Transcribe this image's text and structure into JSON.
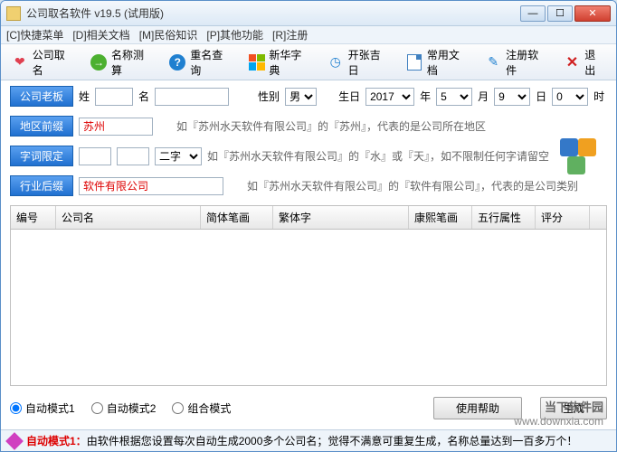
{
  "window": {
    "title": "公司取名软件 v19.5 (试用版)"
  },
  "menu": {
    "m1": "[C]快捷菜单",
    "m2": "[D]相关文档",
    "m3": "[M]民俗知识",
    "m4": "[P]其他功能",
    "m5": "[R]注册"
  },
  "toolbar": {
    "t1": "公司取名",
    "t2": "名称测算",
    "t3": "重名查询",
    "t4": "新华字典",
    "t5": "开张吉日",
    "t6": "常用文档",
    "t7": "注册软件",
    "t8": "退出"
  },
  "form": {
    "boss_btn": "公司老板",
    "surname_lbl": "姓",
    "surname_val": "",
    "given_lbl": "名",
    "given_val": "",
    "gender_lbl": "性别",
    "gender_val": "男",
    "birth_lbl": "生日",
    "year_val": "2017",
    "year_sfx": "年",
    "month_val": "5",
    "month_sfx": "月",
    "day_val": "9",
    "day_sfx": "日",
    "hour_val": "0",
    "hour_sfx": "时",
    "region_btn": "地区前缀",
    "region_val": "苏州",
    "region_hint": "如『苏州水天软件有限公司』的『苏州』，代表的是公司所在地区",
    "limit_btn": "字词限定",
    "limit_val1": "",
    "limit_val2": "",
    "limit_sel": "二字",
    "limit_hint": "如『苏州水天软件有限公司』的『水』或『天』，如不限制任何字请留空",
    "suffix_btn": "行业后缀",
    "suffix_val": "软件有限公司",
    "suffix_hint": "如『苏州水天软件有限公司』的『软件有限公司』，代表的是公司类别"
  },
  "table": {
    "h0": "编号",
    "h1": "公司名",
    "h2": "简体笔画",
    "h3": "繁体字",
    "h4": "康熙笔画",
    "h5": "五行属性",
    "h6": "评分"
  },
  "modes": {
    "m1": "自动模式1",
    "m2": "自动模式2",
    "m3": "组合模式"
  },
  "buttons": {
    "help": "使用帮助",
    "gen": "生成"
  },
  "status": {
    "prefix": "自动模式1：",
    "text": "由软件根据您设置每次自动生成2000多个公司名；觉得不满意可重复生成，名称总量达到一百多万个！"
  },
  "watermark": {
    "line1": "当下软件园",
    "line2": "www.downxia.com"
  }
}
